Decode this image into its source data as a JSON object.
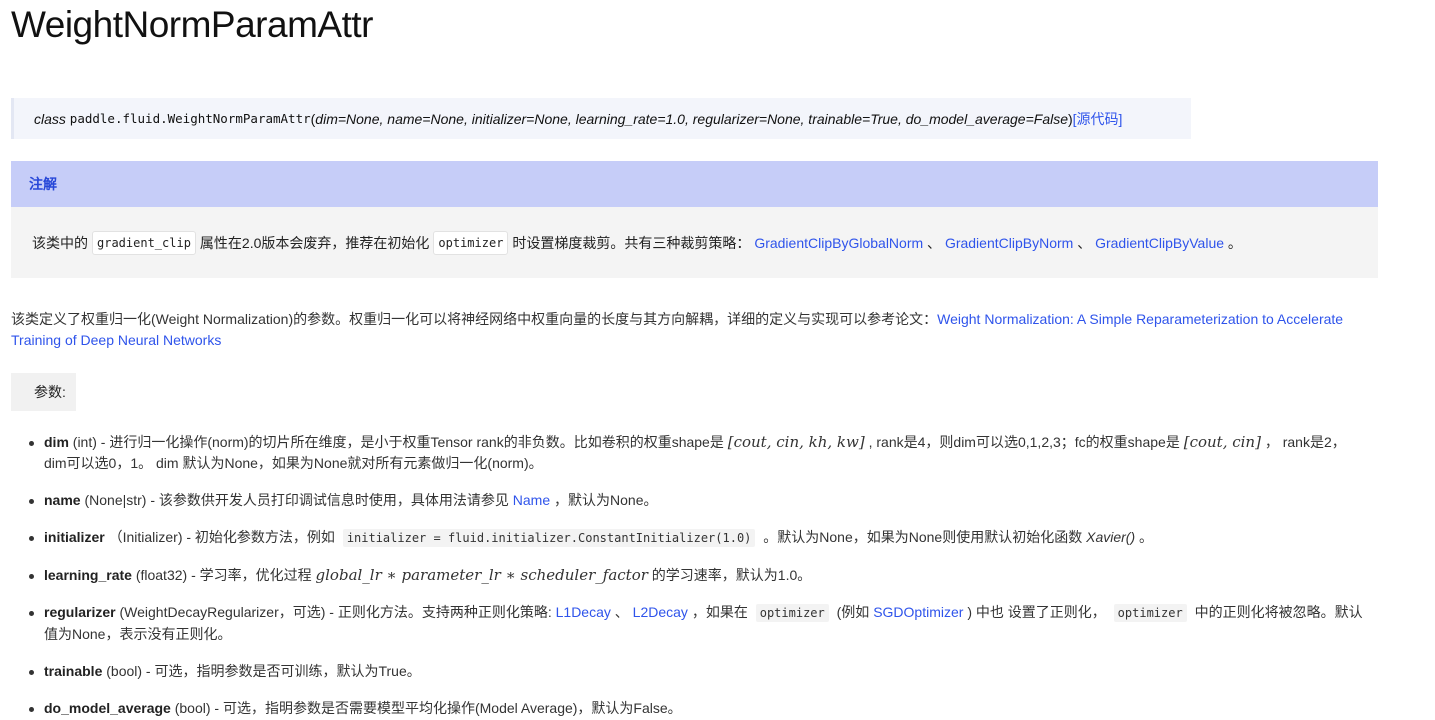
{
  "page_title": "WeightNormParamAttr",
  "signature": {
    "keyword": "class",
    "module_path": "paddle.fluid.WeightNormParamAttr",
    "open_paren": "(",
    "params": "dim=None, name=None, initializer=None, learning_rate=1.0, regularizer=None, trainable=True, do_model_average=False",
    "close_paren": ")",
    "source_link": "[源代码]"
  },
  "note": {
    "heading": "注解",
    "text_1": "该类中的",
    "code_1": "gradient_clip",
    "text_2": "属性在2.0版本会废弃，推荐在初始化",
    "code_2": "optimizer",
    "text_3": "时设置梯度裁剪。共有三种裁剪策略：",
    "link_1": "GradientClipByGlobalNorm",
    "sep_1": "、",
    "link_2": "GradientClipByNorm",
    "sep_2": "、",
    "link_3": "GradientClipByValue",
    "end": "。"
  },
  "description": {
    "text": "该类定义了权重归一化(Weight Normalization)的参数。权重归一化可以将神经网络中权重向量的长度与其方向解耦，详细的定义与实现可以参考论文：",
    "link": "Weight Normalization: A Simple Reparameterization to Accelerate Training of Deep Neural Networks"
  },
  "params_label": "参数:",
  "params": {
    "dim": {
      "name": "dim",
      "text_1": " (int) - 进行归一化操作(norm)的切片所在维度，是小于权重Tensor rank的非负数。比如卷积的权重shape是 ",
      "math_1": "[cout, cin, kh, kw]",
      "text_2": " , rank是4，则dim可以选0,1,2,3；fc的权重shape是 ",
      "math_2": "[cout, cin]",
      "text_3": " ， rank是2，dim可以选0，1。 dim 默认为None，如果为None就对所有元素做归一化(norm)。"
    },
    "name": {
      "name": "name",
      "text_1": " (None|str) - 该参数供开发人员打印调试信息时使用，具体用法请参见 ",
      "link": "Name",
      "text_2": " ，默认为None。"
    },
    "initializer": {
      "name": "initializer",
      "text_1": " （Initializer) - 初始化参数方法，例如 ",
      "code": "initializer = fluid.initializer.ConstantInitializer(1.0)",
      "text_2": " 。默认为None，如果为None则使用默认初始化函数 ",
      "ital": "Xavier()",
      "text_3": " 。"
    },
    "learning_rate": {
      "name": "learning_rate",
      "text_1": " (float32) - 学习率，优化过程 ",
      "math": "global_lr ∗ parameter_lr ∗ scheduler_factor",
      "text_2": " 的学习速率，默认为1.0。"
    },
    "regularizer": {
      "name": "regularizer",
      "text_1": " (WeightDecayRegularizer，可选) - 正则化方法。支持两种正则化策略: ",
      "link_1": "L1Decay",
      "sep": " 、 ",
      "link_2": "L2Decay",
      "text_2": " ，如果在 ",
      "code_1": "optimizer",
      "text_3": " (例如 ",
      "link_3": "SGDOptimizer",
      "text_4": " ) 中也 设置了正则化， ",
      "code_2": "optimizer",
      "text_5": " 中的正则化将被忽略。默认值为None，表示没有正则化。"
    },
    "trainable": {
      "name": "trainable",
      "text": " (bool) - 可选，指明参数是否可训练，默认为True。"
    },
    "do_model_average": {
      "name": "do_model_average",
      "text": " (bool) - 可选，指明参数是否需要模型平均化操作(Model Average)，默认为False。"
    }
  }
}
